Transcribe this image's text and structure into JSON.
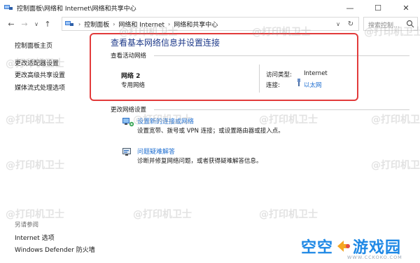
{
  "window": {
    "title": "控制面板\\网络和 Internet\\网络和共享中心",
    "minimize_glyph": "—",
    "maximize_glyph": "☐",
    "close_glyph": "✕"
  },
  "nav": {
    "back_glyph": "←",
    "forward_glyph": "→",
    "recent_glyph": "∨",
    "up_glyph": "↑",
    "breadcrumb": [
      "控制面板",
      "网络和 Internet",
      "网络和共享中心"
    ],
    "separator_glyph": "›",
    "dropdown_glyph": "∨",
    "refresh_glyph": "↻",
    "search_placeholder": "搜索控制..."
  },
  "sidebar": {
    "items": [
      {
        "label": "控制面板主页"
      },
      {
        "label": "更改适配器设置"
      },
      {
        "label": "更改高级共享设置"
      },
      {
        "label": "媒体流式处理选项"
      }
    ],
    "see_also_caption": "另请参阅",
    "see_also": [
      {
        "label": "Internet 选项"
      },
      {
        "label": "Windows Defender 防火墙"
      }
    ]
  },
  "main": {
    "heading": "查看基本网络信息并设置连接",
    "active_networks_label": "查看活动网络",
    "network": {
      "name": "网络 2",
      "type": "专用网络",
      "access_type_key": "访问类型:",
      "access_type_value": "Internet",
      "connection_key": "连接:",
      "connection_value": "以太网"
    },
    "change_settings_label": "更改网络设置",
    "tasks": [
      {
        "link": "设置新的连接或网络",
        "desc": "设置宽带、拨号或 VPN 连接；或设置路由器或接入点。",
        "icon": "network-setup-icon"
      },
      {
        "link": "问题疑难解答",
        "desc": "诊断并修复网络问题，或者获得疑难解答信息。",
        "icon": "troubleshoot-icon"
      }
    ]
  },
  "watermark_text": "@打印机卫士",
  "brand": {
    "left_text": "空空",
    "right_text": "游戏园",
    "url": "WWW.CCKOKO.COM"
  },
  "colors": {
    "heading": "#1e3a8a",
    "link": "#1f6fd1",
    "highlight_border": "#e23b3b",
    "brand_blue": "#1e88e5",
    "brand_orange": "#f5a623"
  }
}
